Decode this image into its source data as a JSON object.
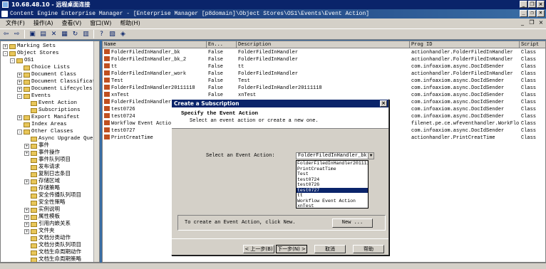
{
  "rdp_title": "10.68.48.10 - 远程桌面连接",
  "app_title": "Content Engine Enterprise Manager - [Enterprise Manager [p8domain]\\Object Stores\\OS1\\Events\\Event Action]",
  "menu": [
    "文件(F)",
    "操作(A)",
    "查看(V)",
    "窗口(W)",
    "帮助(H)"
  ],
  "tree": [
    {
      "label": "Marking Sets",
      "exp": "+",
      "indent": 0
    },
    {
      "label": "Object Stores",
      "exp": "-",
      "indent": 0
    },
    {
      "label": "OS1",
      "exp": "-",
      "indent": 1
    },
    {
      "label": "Choice Lists",
      "exp": "",
      "indent": 2
    },
    {
      "label": "Document Class",
      "exp": "+",
      "indent": 2
    },
    {
      "label": "Document Classificati",
      "exp": "+",
      "indent": 2
    },
    {
      "label": "Document Lifecycles",
      "exp": "+",
      "indent": 2
    },
    {
      "label": "Events",
      "exp": "-",
      "indent": 2
    },
    {
      "label": "Event Action",
      "exp": "",
      "indent": 3
    },
    {
      "label": "Subscriptions",
      "exp": "",
      "indent": 3
    },
    {
      "label": "Export Manifest",
      "exp": "+",
      "indent": 2
    },
    {
      "label": "Index Areas",
      "exp": "",
      "indent": 2
    },
    {
      "label": "Other Classes",
      "exp": "-",
      "indent": 2
    },
    {
      "label": "Async Upgrade Queu",
      "exp": "",
      "indent": 3
    },
    {
      "label": "事件",
      "exp": "+",
      "indent": 3
    },
    {
      "label": "事件操作",
      "exp": "+",
      "indent": 3
    },
    {
      "label": "事件队列项目",
      "exp": "",
      "indent": 3
    },
    {
      "label": "发布请求",
      "exp": "",
      "indent": 3
    },
    {
      "label": "复制日志条目",
      "exp": "",
      "indent": 3
    },
    {
      "label": "存储区域",
      "exp": "+",
      "indent": 3
    },
    {
      "label": "存储策略",
      "exp": "",
      "indent": 3
    },
    {
      "label": "安全传播队列项目",
      "exp": "",
      "indent": 3
    },
    {
      "label": "安全性策略",
      "exp": "",
      "indent": 3
    },
    {
      "label": "实例说明",
      "exp": "+",
      "indent": 3
    },
    {
      "label": "属性模板",
      "exp": "+",
      "indent": 3
    },
    {
      "label": "引用内嵌关系",
      "exp": "+",
      "indent": 3
    },
    {
      "label": "文件夹",
      "exp": "+",
      "indent": 3
    },
    {
      "label": "文档分类动作",
      "exp": "",
      "indent": 3
    },
    {
      "label": "文档分类队列项目",
      "exp": "",
      "indent": 3
    },
    {
      "label": "文档生命周期动作",
      "exp": "",
      "indent": 3
    },
    {
      "label": "文档生命周期策略",
      "exp": "",
      "indent": 3
    }
  ],
  "list": {
    "headers": [
      "Name",
      "En... ",
      "Description",
      "Prog ID",
      "Script"
    ],
    "rows": [
      [
        "FolderFiledInHandler_bk",
        "False",
        "FolderFiledInHandler",
        "actionhandler.FolderFiledInHandler",
        "Class"
      ],
      [
        "FolderFiledInHandler_bk_2",
        "False",
        "FolderFiledInHandler",
        "actionhandler.FolderFiledInHandler",
        "Class"
      ],
      [
        "tt",
        "False",
        "tt",
        "com.infoaxiom.async.DocIdSender",
        "Class"
      ],
      [
        "FolderFiledInHandler_work",
        "False",
        "FolderFiledInHandler",
        "actionhandler.FolderFiledInHandler",
        "Class"
      ],
      [
        "Test",
        "False",
        "Test",
        "com.infoaxiom.async.DocIdSender",
        "Class"
      ],
      [
        "FolderFiledInHandler20111118",
        "False",
        "FolderFiledInHandler20111118",
        "com.infoaxiom.async.DocIdSender",
        "Class"
      ],
      [
        "xnTest",
        "False",
        "xnTest",
        "com.infoaxiom.async.DocIdSender",
        "Class"
      ],
      [
        "FolderFiledInHandler20",
        "",
        "",
        "com.infoaxiom.async.DocIdSender",
        "Class"
      ],
      [
        "test0726",
        "",
        "",
        "com.infoaxiom.async.DocIdSender",
        "Class"
      ],
      [
        "test0724",
        "",
        "",
        "com.infoaxiom.async.DocIdSender",
        "Class"
      ],
      [
        "Workflow Event Action",
        "",
        "",
        "filenet.pe.ce.wfeventhandler.WorkFlo...",
        "Class"
      ],
      [
        "test0727",
        "",
        "",
        "com.infoaxiom.async.DocIdSender",
        "Class"
      ],
      [
        "PrintCreatTime",
        "",
        "",
        "actionhandler.PrintCreatTime",
        "Class"
      ]
    ]
  },
  "dialog": {
    "title": "Create a Subscription",
    "close": "×",
    "heading": "Specify the Event Action",
    "subheading": "Select an event action or create a new one.",
    "select_label": "Select an Event Action:",
    "select_value": "FolderFiledInHandler_bk",
    "options": [
      "FolderFiledInHandler2011111",
      "PrintCreatTime",
      "Test",
      "test0724",
      "test0726",
      "test0727",
      "tt",
      "Workflow Event Action",
      "xnTest"
    ],
    "selected_option": 5,
    "hint": "To create an Event Action, click New.",
    "new_button": "New ...",
    "back_button": "< 上一步(B)",
    "next_button": "下一步(N) >",
    "cancel_button": "取消",
    "help_button": "帮助"
  }
}
